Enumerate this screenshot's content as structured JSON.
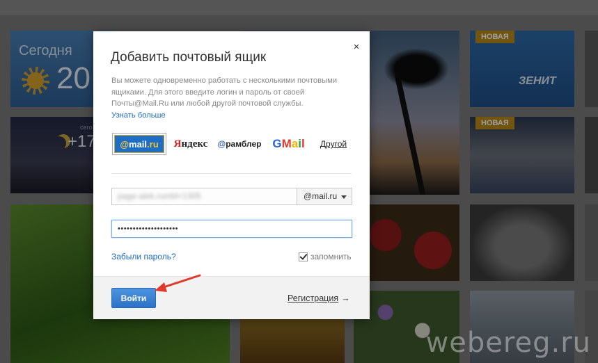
{
  "background": {
    "weather_today_title": "Сегодня",
    "weather_today_temp": "20",
    "weather_tonight_label": "сего",
    "weather_tonight_temp": "+17",
    "badge_new_1": "НОВАЯ",
    "badge_new_2": "НОВАЯ",
    "football_logo_text": "ЗЕНИТ",
    "watermark": "webereg.ru"
  },
  "modal": {
    "title": "Добавить почтовый ящик",
    "close_symbol": "×",
    "description": "Вы можете одновременно работать с несколькими почтовыми ящиками. Для этого введите логин и пароль от своей Почты@Mail.Ru или любой другой почтовой службы.",
    "learn_more": "Узнать больше",
    "providers": {
      "mailru_at": "@",
      "mailru_name": "mail",
      "mailru_ru": ".ru",
      "yandex_first": "Я",
      "yandex_rest": "ндекс",
      "rambler_at": "@",
      "rambler_rest": "рамблер",
      "gmail_g": "G",
      "gmail_m": "M",
      "gmail_a": "a",
      "gmail_i": "i",
      "gmail_l": "l",
      "other": "Другой"
    },
    "login_value": "page-alek.rumbl+1305",
    "domain_selected": "@mail.ru",
    "password_masked": "••••••••••••••••••••",
    "forgot_password": "Забыли пароль?",
    "remember_label": "запомнить",
    "remember_checked": true,
    "submit_label": "Войти",
    "register_label": "Регистрация",
    "register_arrow": "→"
  },
  "colors": {
    "accent_blue": "#2c73c8",
    "link_blue": "#1b6ac9",
    "annotation_red": "#e03a2a"
  }
}
